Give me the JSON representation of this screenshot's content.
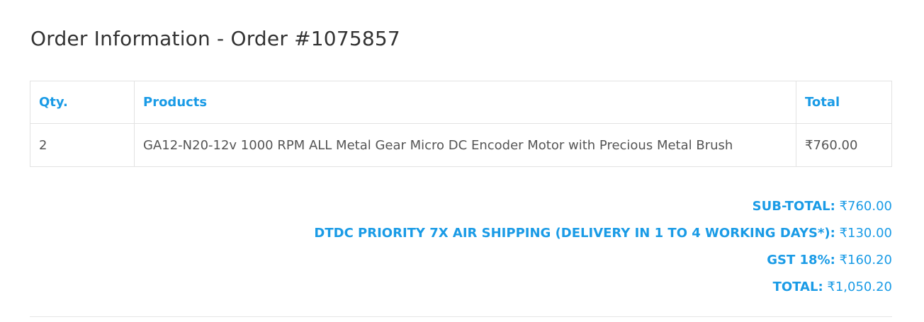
{
  "page": {
    "title": "Order Information - Order #1075857"
  },
  "table": {
    "headers": {
      "qty": "Qty.",
      "products": "Products",
      "total": "Total"
    },
    "rows": [
      {
        "qty": "2",
        "product": "GA12-N20-12v 1000 RPM ALL Metal Gear Micro DC Encoder Motor with Precious Metal Brush",
        "total": "₹760.00"
      }
    ]
  },
  "totals": [
    {
      "label": "SUB-TOTAL:",
      "value": "₹760.00"
    },
    {
      "label": "DTDC PRIORITY 7X AIR SHIPPING (DELIVERY IN 1 TO 4 WORKING DAYS*):",
      "value": "₹130.00"
    },
    {
      "label": "GST 18%:",
      "value": "₹160.20"
    },
    {
      "label": "TOTAL:",
      "value": "₹1,050.20"
    }
  ],
  "colors": {
    "accent": "#1a9be6",
    "text": "#555555",
    "heading": "#333333",
    "border": "#e2e2e2"
  }
}
